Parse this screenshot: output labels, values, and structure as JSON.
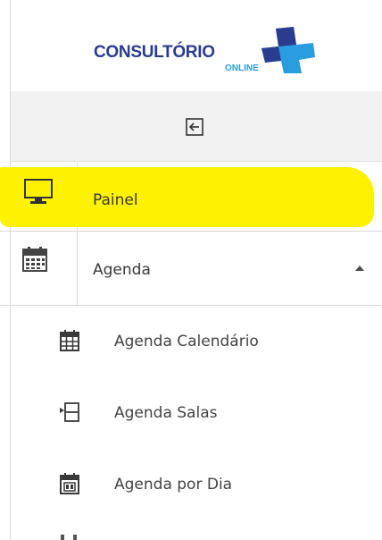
{
  "brand": {
    "name": "CONSULTÓRIO",
    "sub": "ONLINE",
    "colors": {
      "navy": "#2b3c8f",
      "blue": "#2a9de0",
      "highlight": "#fff200"
    }
  },
  "collapse": {
    "icon": "collapse-sidebar-icon"
  },
  "menu": [
    {
      "label": "Painel",
      "icon": "monitor-icon",
      "highlighted": true
    },
    {
      "label": "Agenda",
      "icon": "calendar-icon",
      "expanded": true
    }
  ],
  "submenu": [
    {
      "label": "Agenda Calendário",
      "icon": "calendar-grid-icon"
    },
    {
      "label": "Agenda Salas",
      "icon": "rooms-icon"
    },
    {
      "label": "Agenda por Dia",
      "icon": "calendar-day-icon"
    }
  ]
}
